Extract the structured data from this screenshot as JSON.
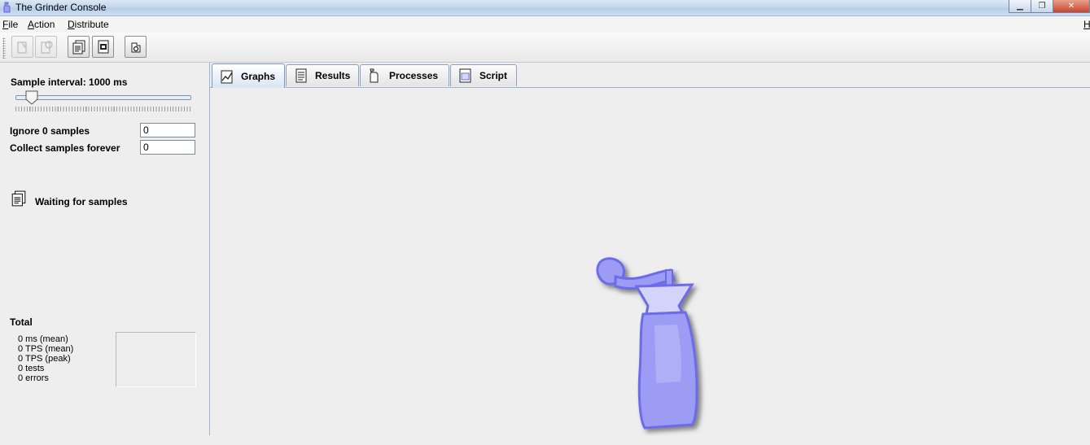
{
  "window": {
    "title": "The Grinder Console",
    "controls": [
      "minimize-icon",
      "restore-icon",
      "close-icon"
    ]
  },
  "menubar": {
    "items": [
      "File",
      "Action",
      "Distribute"
    ],
    "right_item": "H"
  },
  "toolbar": {
    "buttons": [
      {
        "icon": "start-processes-icon",
        "enabled": false
      },
      {
        "icon": "reset-processes-icon",
        "enabled": false
      },
      {
        "icon": "start-capture-icon",
        "enabled": true
      },
      {
        "icon": "stop-capture-icon",
        "enabled": true
      },
      {
        "icon": "reset-stats-icon",
        "enabled": true
      }
    ]
  },
  "left_panel": {
    "sample_interval_label": "Sample interval: 1000 ms",
    "ignore_label": "Ignore 0 samples",
    "ignore_value": "0",
    "collect_label": "Collect samples forever",
    "collect_value": "0",
    "status_text": "Waiting for samples",
    "total_label": "Total",
    "stats": [
      "0 ms (mean)",
      "0 TPS (mean)",
      "0 TPS (peak)",
      "0 tests",
      "0 errors"
    ]
  },
  "tabs": [
    {
      "label": "Graphs",
      "icon": "graph-icon",
      "active": true
    },
    {
      "label": "Results",
      "icon": "results-icon",
      "active": false
    },
    {
      "label": "Processes",
      "icon": "processes-icon",
      "active": false
    },
    {
      "label": "Script",
      "icon": "script-icon",
      "active": false
    }
  ],
  "colors": {
    "logo_fill": "#9c9cf4",
    "logo_outline": "#6c6ce8",
    "tab_border": "#8da2c0"
  }
}
